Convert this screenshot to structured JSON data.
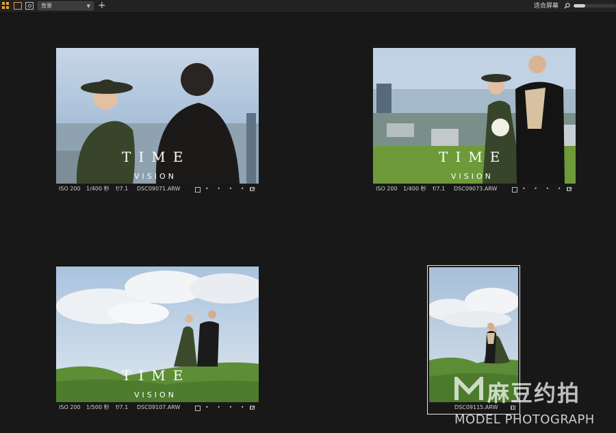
{
  "toolbar": {
    "view_select": "背景",
    "fit_label": "适合屏幕",
    "zoom_level_percent": 28
  },
  "thumbnails": [
    {
      "iso": "ISO 200",
      "shutter": "1/400 秒",
      "aperture": "f/7.1",
      "filename": "DSC09071.ARW",
      "dots": "• • • • •"
    },
    {
      "iso": "ISO 200",
      "shutter": "1/400 秒",
      "aperture": "f/7.1",
      "filename": "DSC09073.ARW",
      "dots": "• • • • •"
    },
    {
      "iso": "ISO 200",
      "shutter": "1/500 秒",
      "aperture": "f/7.1",
      "filename": "DSC09107.ARW",
      "dots": "• • • • •"
    },
    {
      "filename": "DSC09115.ARW"
    }
  ],
  "watermark": {
    "word1": "TIME",
    "word2": "VISION",
    "brand_cn": "麻豆约拍",
    "brand_en": "MODEL PHOTOGRAPH"
  },
  "colors": {
    "accent": "#e7a33a",
    "background": "#181818",
    "toolbar": "#222222"
  }
}
